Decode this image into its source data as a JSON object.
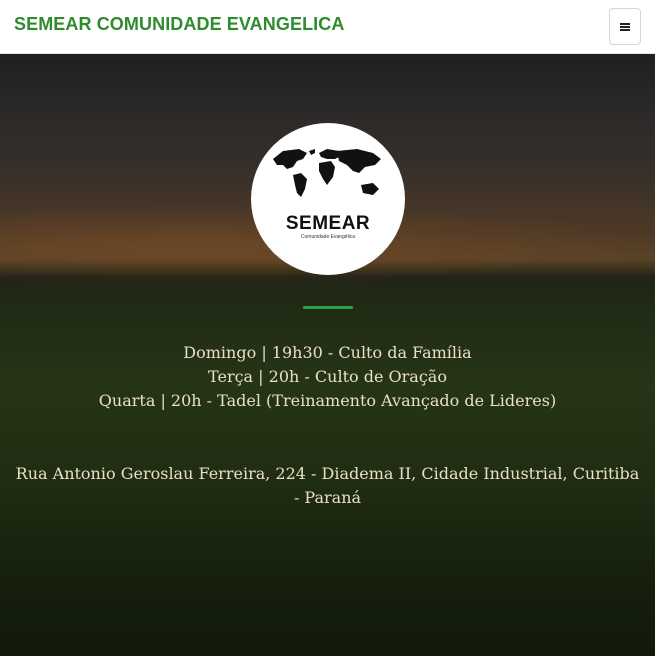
{
  "navbar": {
    "brand": "SEMEAR COMUNIDADE EVANGELICA",
    "menu_icon": "hamburger-menu-icon"
  },
  "logo": {
    "title": "SEMEAR",
    "subtitle": "Comunidade Evangélica",
    "icon": "world-map-icon"
  },
  "colors": {
    "brand": "#2e8b2e",
    "divider": "#2ea043",
    "text": "#e9dfc9"
  },
  "schedule": [
    "Domingo | 19h30 - Culto da Família",
    "Terça | 20h - Culto de Oração",
    "Quarta | 20h - Tadel (Treinamento Avançado de Lideres)"
  ],
  "address": "Rua Antonio Geroslau Ferreira, 224 - Diadema II, Cidade Industrial, Curitiba - Paraná"
}
